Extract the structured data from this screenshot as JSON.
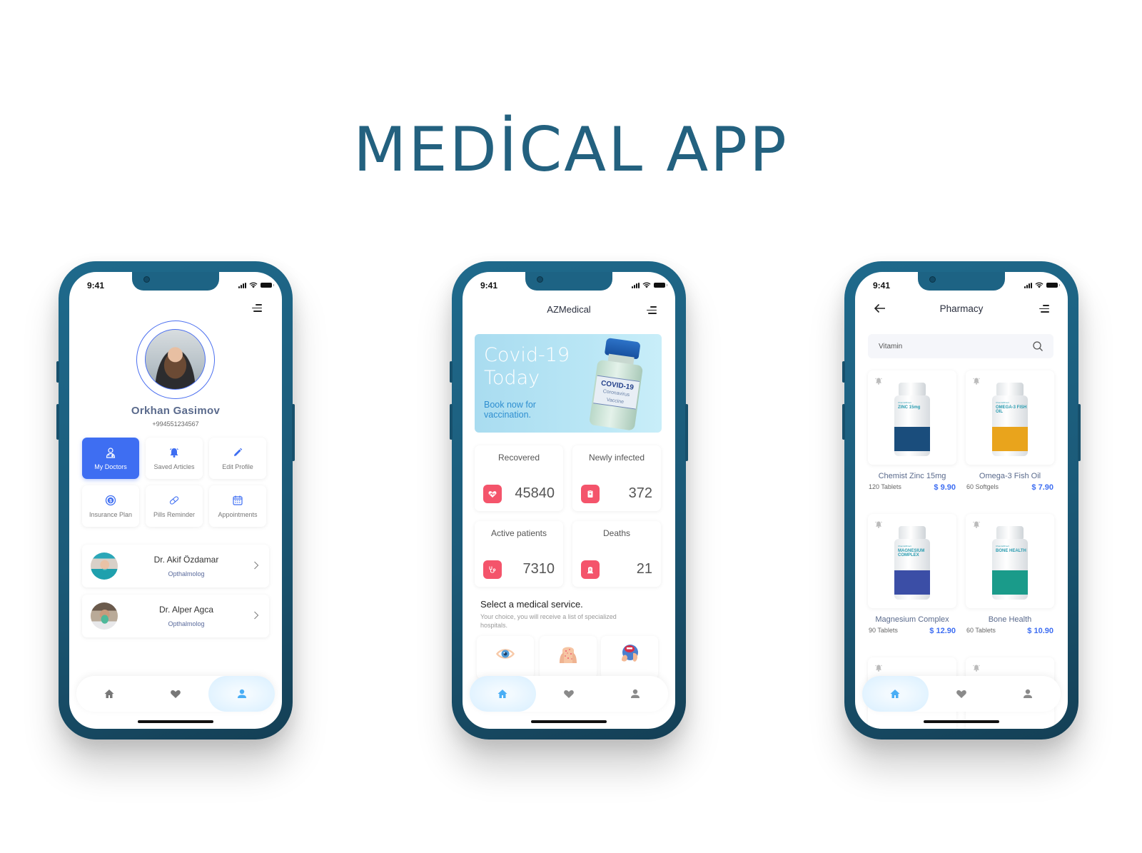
{
  "page": {
    "title": "MEDİCAL APP",
    "accent": "#23617f"
  },
  "status_bar": {
    "time": "9:41"
  },
  "profile_screen": {
    "user": {
      "name": "Orkhan Gasimov",
      "phone": "+994551234567"
    },
    "actions": [
      {
        "label": "My Doctors",
        "icon": "doctor-icon",
        "active": true
      },
      {
        "label": "Saved Articles",
        "icon": "bell-icon",
        "active": false
      },
      {
        "label": "Edit Profile",
        "icon": "pencil-icon",
        "active": false
      },
      {
        "label": "Insurance Plan",
        "icon": "dollar-icon",
        "active": false
      },
      {
        "label": "Pills Reminder",
        "icon": "pill-icon",
        "active": false
      },
      {
        "label": "Appointments",
        "icon": "calendar-icon",
        "active": false
      }
    ],
    "doctors": [
      {
        "name": "Dr. Akif Özdamar",
        "specialty": "Opthalmolog"
      },
      {
        "name": "Dr. Alper Agca",
        "specialty": "Opthalmolog"
      }
    ],
    "nav_active": "profile"
  },
  "home_screen": {
    "app_title": "AZMedical",
    "banner": {
      "title": "Covid-19\nToday",
      "subtitle": "Book now for\nvaccination.",
      "vial_label": "COVID-19",
      "vial_sublabel": "Coronavirus Vaccine"
    },
    "stats": [
      {
        "label": "Recovered",
        "value": "45840",
        "icon": "heart-pulse-icon"
      },
      {
        "label": "Newly infected",
        "value": "372",
        "icon": "clipboard-icon"
      },
      {
        "label": "Active patients",
        "value": "7310",
        "icon": "stethoscope-icon"
      },
      {
        "label": "Deaths",
        "value": "21",
        "icon": "tombstone-icon"
      }
    ],
    "service_title": "Select a medical service.",
    "service_subtitle": "Your choice, you will receive a list of specialized hospitals.",
    "services": [
      {
        "icon": "eye-icon"
      },
      {
        "icon": "skin-icon"
      },
      {
        "icon": "ent-icon"
      }
    ],
    "nav_active": "home",
    "stat_icon_color": "#f4546b"
  },
  "pharmacy_screen": {
    "title": "Pharmacy",
    "search": {
      "value": "Vitamin",
      "placeholder": "Vitamin"
    },
    "products": [
      {
        "name": "Chemist Zinc 15mg",
        "qty": "120 Tablets",
        "price": "$ 9.90",
        "bottle_label": "ZINC\n15mg",
        "band_color": "#1a4d7c"
      },
      {
        "name": "Omega-3 Fish Oil",
        "qty": "60 Softgels",
        "price": "$ 7.90",
        "bottle_label": "OMEGA-3\nFISH OIL",
        "band_color": "#e9a41c"
      },
      {
        "name": "Magnesium Complex",
        "qty": "90 Tablets",
        "price": "$ 12.90",
        "bottle_label": "MAGNESIUM\nCOMPLEX",
        "band_color": "#3b4ea6"
      },
      {
        "name": "Bone Health",
        "qty": "60 Tablets",
        "price": "$ 10.90",
        "bottle_label": "BONE HEALTH",
        "band_color": "#1a9b8a"
      }
    ],
    "nav_active": "home",
    "price_color": "#3e6ef2"
  }
}
